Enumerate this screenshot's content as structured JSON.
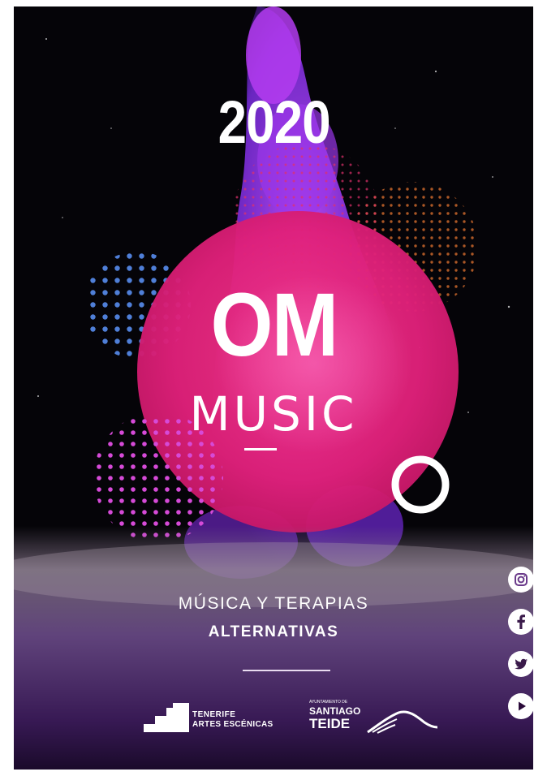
{
  "poster": {
    "year": "2020",
    "title_main": "OM",
    "title_sub": "MUSIC",
    "tagline_line1": "MÚSICA Y TERAPIAS",
    "tagline_line2": "ALTERNATIVAS"
  },
  "logos": {
    "tenerife": {
      "line1": "TENERIFE",
      "line2": "ARTES ESCÉNICAS"
    },
    "santiago": {
      "line0": "AYUNTAMIENTO DE",
      "line1": "SANTIAGO",
      "line2": "TEIDE"
    }
  },
  "social_icons": [
    "instagram-icon",
    "facebook-icon",
    "twitter-icon",
    "youtube-icon"
  ],
  "colors": {
    "background": "#050408",
    "circle": "#e0207a",
    "smoke": "#8a2be2",
    "dots_blue": "#4f7fd8",
    "dots_magenta": "#d64ad8",
    "dots_orange": "#c8662a",
    "fog": "#7a4a9a"
  }
}
